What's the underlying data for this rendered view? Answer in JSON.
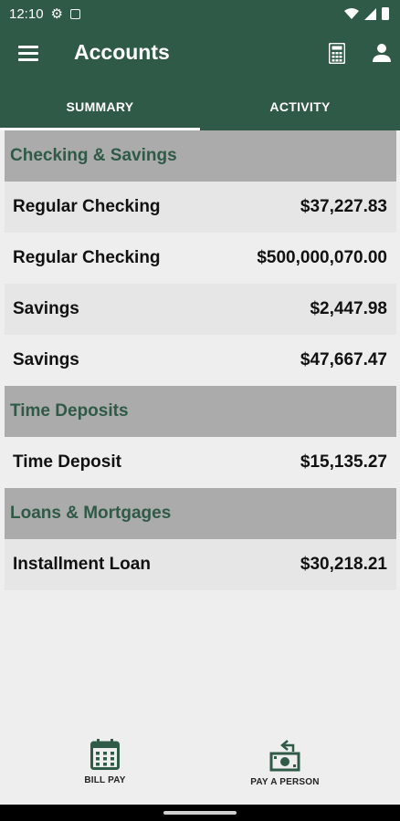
{
  "status_bar": {
    "time": "12:10"
  },
  "app_bar": {
    "title": "Accounts"
  },
  "tabs": [
    {
      "label": "SUMMARY",
      "active": true
    },
    {
      "label": "ACTIVITY",
      "active": false
    }
  ],
  "sections": [
    {
      "title": "Checking & Savings",
      "accounts": [
        {
          "name": "Regular Checking",
          "balance": "$37,227.83"
        },
        {
          "name": "Regular Checking",
          "balance": "$500,000,070.00"
        },
        {
          "name": "Savings",
          "balance": "$2,447.98"
        },
        {
          "name": "Savings",
          "balance": "$47,667.47"
        }
      ]
    },
    {
      "title": "Time Deposits",
      "accounts": [
        {
          "name": "Time Deposit",
          "balance": "$15,135.27"
        }
      ]
    },
    {
      "title": "Loans & Mortgages",
      "accounts": [
        {
          "name": "Installment Loan",
          "balance": "$30,218.21"
        }
      ]
    }
  ],
  "bottom_nav": {
    "bill_pay": "BILL PAY",
    "pay_a_person": "PAY A PERSON"
  },
  "colors": {
    "brand": "#2f5a47",
    "section_header_bg": "#ababab",
    "row_bg": "#e6e6e6",
    "page_bg": "#eeeeee"
  },
  "icons": [
    "gear-icon",
    "message-icon",
    "wifi-icon",
    "signal-icon",
    "battery-icon",
    "menu-icon",
    "calculator-icon",
    "user-icon",
    "calendar-icon",
    "pay-person-icon"
  ]
}
